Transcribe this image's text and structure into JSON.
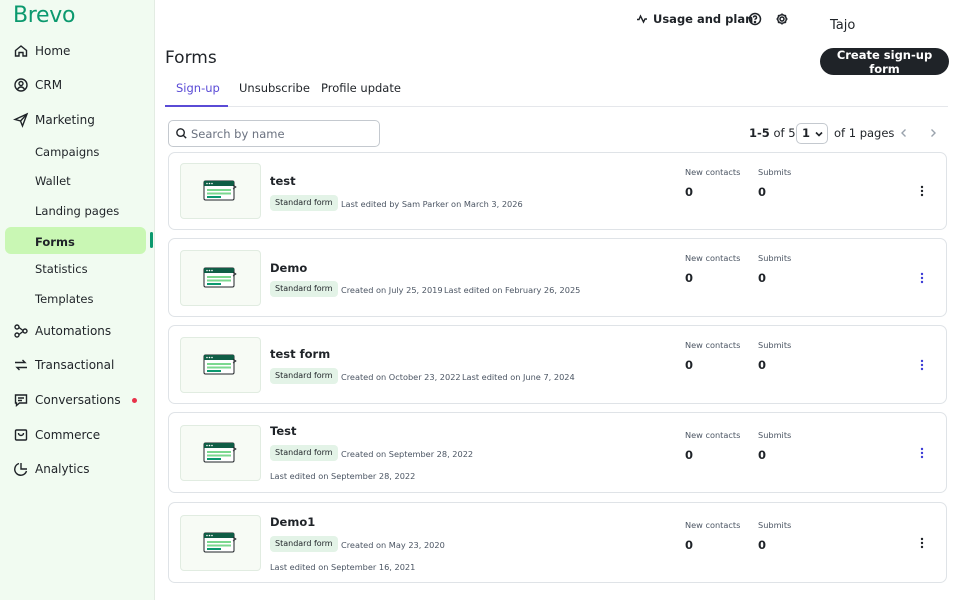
{
  "sidebar": {
    "logo": "Brevo",
    "items": [
      {
        "label": "Home",
        "icon": "home-icon"
      },
      {
        "label": "CRM",
        "icon": "contact-icon"
      },
      {
        "label": "Marketing",
        "icon": "send-icon"
      },
      {
        "label": "Campaigns"
      },
      {
        "label": "Wallet"
      },
      {
        "label": "Landing pages"
      },
      {
        "label": "Forms",
        "active": true
      },
      {
        "label": "Statistics"
      },
      {
        "label": "Templates"
      },
      {
        "label": "Automations",
        "icon": "automation-icon"
      },
      {
        "label": "Transactional",
        "icon": "transactional-icon"
      },
      {
        "label": "Conversations",
        "icon": "chat-icon",
        "notification": true
      },
      {
        "label": "Commerce",
        "icon": "commerce-icon"
      },
      {
        "label": "Analytics",
        "icon": "analytics-icon"
      }
    ]
  },
  "topbar": {
    "usage_label": "Usage and plan",
    "user_name": "Tajo"
  },
  "header": {
    "title": "Forms",
    "create_button": "Create sign-up form"
  },
  "tabs": [
    {
      "label": "Sign-up",
      "active": true
    },
    {
      "label": "Unsubscribe"
    },
    {
      "label": "Profile update"
    }
  ],
  "search": {
    "placeholder": "Search by name",
    "value": ""
  },
  "pagination": {
    "range": "1-5",
    "of_label": "of",
    "total": "5",
    "current_page": "1",
    "pages_label": "of 1 pages"
  },
  "stats_labels": {
    "new_contacts": "New contacts",
    "submits": "Submits"
  },
  "forms": [
    {
      "name": "test",
      "type": "Standard form",
      "created": "",
      "edited": "Last edited by Sam Parker on March 3, 2026",
      "new_contacts": "0",
      "submits": "0"
    },
    {
      "name": "Demo",
      "type": "Standard form",
      "created": "Created on July 25, 2019",
      "edited": "Last edited on February 26, 2025",
      "new_contacts": "0",
      "submits": "0"
    },
    {
      "name": "test form",
      "type": "Standard form",
      "created": "Created on October 23, 2022",
      "edited": "Last edited on June 7, 2024",
      "new_contacts": "0",
      "submits": "0"
    },
    {
      "name": "Test",
      "type": "Standard form",
      "created": "Created on September 28, 2022",
      "edited": "Last edited on September 28, 2022",
      "new_contacts": "0",
      "submits": "0"
    },
    {
      "name": "Demo1",
      "type": "Standard form",
      "created": "Created on May 23, 2020",
      "edited": "Last edited on September 16, 2021",
      "new_contacts": "0",
      "submits": "0"
    }
  ],
  "colors": {
    "brand": "#0b996e",
    "active_tab": "#5a4bd6",
    "active_nav": "#c9f7b4",
    "sidebar_bg": "#f1fbf1",
    "primary_button": "#1f2328",
    "notification_dot": "#e8324a"
  }
}
